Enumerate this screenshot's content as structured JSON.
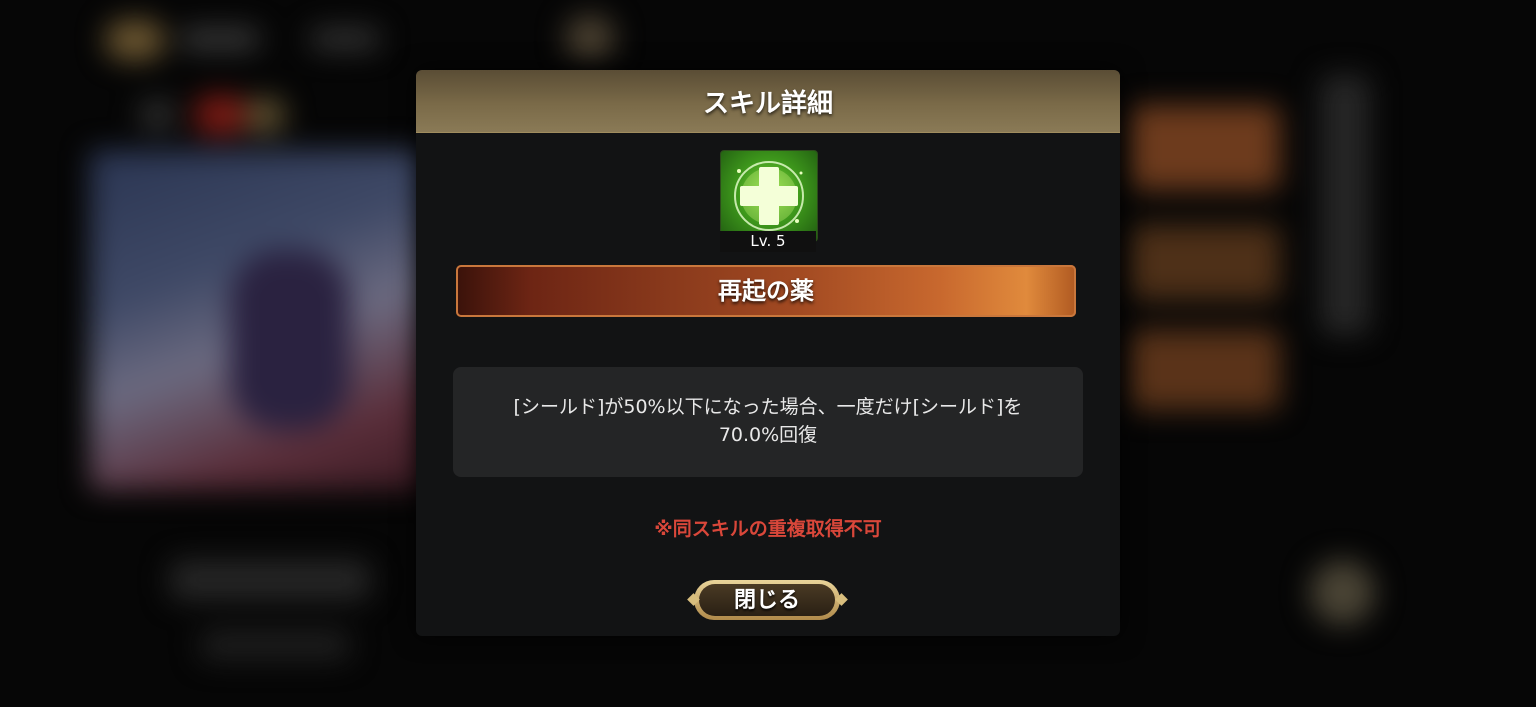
{
  "dialog": {
    "title": "スキル詳細",
    "skill": {
      "icon": "green-cross-icon",
      "level_label": "Lv. 5",
      "name": "再起の薬"
    },
    "description_line1": "[シールド]が50%以下になった場合、一度だけ[シールド]を",
    "description_line2": "70.0%回復",
    "note": "※同スキルの重複取得不可",
    "close_label": "閉じる"
  },
  "colors": {
    "header_gold": "#7a6a48",
    "note_red": "#d9473a",
    "icon_green": "#3f9a1c",
    "banner_orange": "#c8682e"
  }
}
